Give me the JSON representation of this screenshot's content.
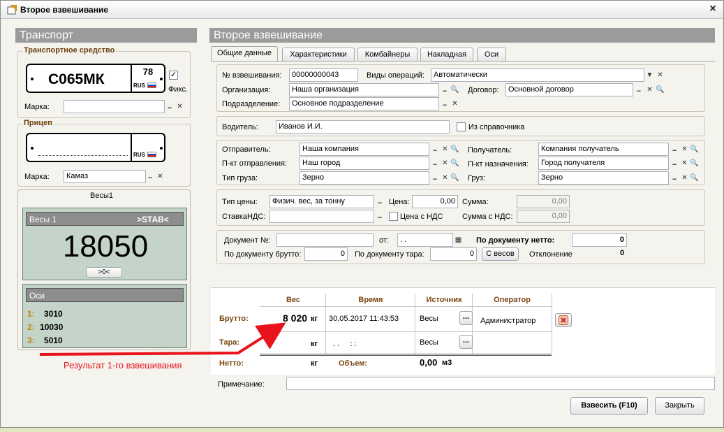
{
  "window": {
    "title": "Второе взвешивание",
    "close": "×"
  },
  "left": {
    "header": "Транспорт",
    "vehicle": {
      "group_title": "Транспортное средство",
      "plate_number": "С065МК",
      "plate_region": "78",
      "plate_country": "RUS",
      "fix_label": "Фикс.",
      "fix_checked": "✓",
      "brand_label": "Марка:",
      "brand_value": ""
    },
    "trailer": {
      "group_title": "Прицеп",
      "plate_number": "",
      "plate_country": "RUS",
      "brand_label": "Марка:",
      "brand_value": "Камаз"
    },
    "scale": {
      "tab_label": "Весы1",
      "name": "Весы 1",
      "status": ">STAB<",
      "weight": "18050",
      "zero_button": ">0<",
      "axles_title": "Оси",
      "axles": [
        {
          "index": "1:",
          "value": "3010"
        },
        {
          "index": "2:",
          "value": "10030"
        },
        {
          "index": "3:",
          "value": "5010"
        }
      ]
    }
  },
  "right": {
    "header": "Второе взвешивание",
    "tabs": [
      "Общие данные",
      "Характеристики",
      "Комбайнеры",
      "Накладная",
      "Оси"
    ],
    "general": {
      "weighing_no_label": "№ взвешивания:",
      "weighing_no": "00000000043",
      "op_types_label": "Виды операций:",
      "op_types": "Автоматически",
      "org_label": "Организация:",
      "org": "Наша организация",
      "contract_label": "Договор:",
      "contract": "Основной договор",
      "division_label": "Подразделение:",
      "division": "Основное подразделение"
    },
    "driver": {
      "label": "Водитель:",
      "value": "Иванов И.И.",
      "from_ref_label": "Из справочника"
    },
    "route": {
      "sender_label": "Отправитель:",
      "sender": "Наша компания",
      "receiver_label": "Получатель:",
      "receiver": "Компания получатель",
      "dep_label": "П-кт отправления:",
      "dep": "Наш город",
      "dest_label": "П-кт назначения:",
      "dest": "Город получателя",
      "cargo_type_label": "Тип груза:",
      "cargo_type": "Зерно",
      "cargo_label": "Груз:",
      "cargo": "Зерно"
    },
    "price": {
      "price_type_label": "Тип цены:",
      "price_type": "Физич. вес, за тонну",
      "price_label": "Цена:",
      "price": "0,00",
      "sum_label": "Сумма:",
      "sum": "0,00",
      "vat_rate_label": "СтавкаНДС:",
      "vat_rate": "",
      "price_vat_label": "Цена с НДС",
      "sum_vat_label": "Сумма с НДС:",
      "sum_vat": "0,00"
    },
    "document": {
      "doc_no_label": "Документ №:",
      "doc_no": "",
      "from_label": "от:",
      "from_date": ". .",
      "net_doc_label": "По документу нетто:",
      "net_doc": "0",
      "gross_doc_label": "По документу брутто:",
      "gross_doc": "0",
      "tare_doc_label": "По документу тара:",
      "tare_doc": "0",
      "from_scales_button": "С весов",
      "deviation_label": "Отклонение",
      "deviation": "0"
    },
    "table": {
      "headers": {
        "weight": "Вес",
        "time": "Время",
        "source": "Источник",
        "operator": "Оператор"
      },
      "gross": {
        "label": "Брутто:",
        "weight": "8 020",
        "unit": "кг",
        "time": "30.05.2017 11:43:53",
        "source": "Весы",
        "operator": "Администратор"
      },
      "tare": {
        "label": "Тара:",
        "weight": "",
        "unit": "кг",
        "time": ". .     : :",
        "source": "Весы"
      },
      "net": {
        "label": "Нетто:",
        "weight": "",
        "unit": "кг",
        "volume_label": "Объем:",
        "volume": "0,00",
        "volume_unit": "м3"
      }
    },
    "note_label": "Примечание:",
    "note": "",
    "weigh_button": "Взвесить (F10)",
    "close_button": "Закрыть"
  },
  "annotation": {
    "text": "Результат 1-го взвешивания",
    "color": "#e8131b"
  }
}
